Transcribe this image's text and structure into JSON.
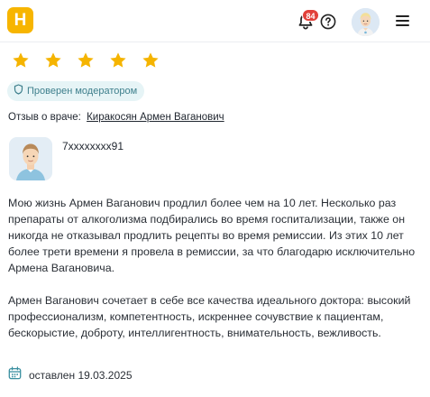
{
  "header": {
    "logo_letter": "H",
    "notifications_count": "84"
  },
  "rating": {
    "stars": 5,
    "max": 5,
    "color": "#f5b400"
  },
  "verified_badge": "Проверен модератором",
  "review_for": {
    "label": "Отзыв о враче:",
    "doctor_name": "Киракосян Армен Ваганович"
  },
  "author": {
    "name": "7xxxxxxxx91"
  },
  "review": {
    "paragraphs": [
      " Мою жизнь Армен Ваганович продлил более чем на 10 лет. Несколько раз препараты от алкоголизма подбирались во время госпитализации, также он никогда не отказывал продлить рецепты во время ремиссии. Из этих 10 лет более трети времени я провела в ремиссии, за что благодарю исключительно Армена Вагановича.",
      "Армен Ваганович сочетает в себе все качества идеального доктора: высокий профессионализм, компетентность, искреннее сочувствие к пациентам, бескорыстие, доброту, интеллигентность, внимательность, вежливость."
    ]
  },
  "date": {
    "text": "оставлен 19.03.2025"
  },
  "colors": {
    "logo": "#f7b500",
    "badge": "#e2413a",
    "verified_bg": "#e6f4f6",
    "verified_text": "#3e7f8c",
    "calendar_icon": "#3a8fa0"
  }
}
